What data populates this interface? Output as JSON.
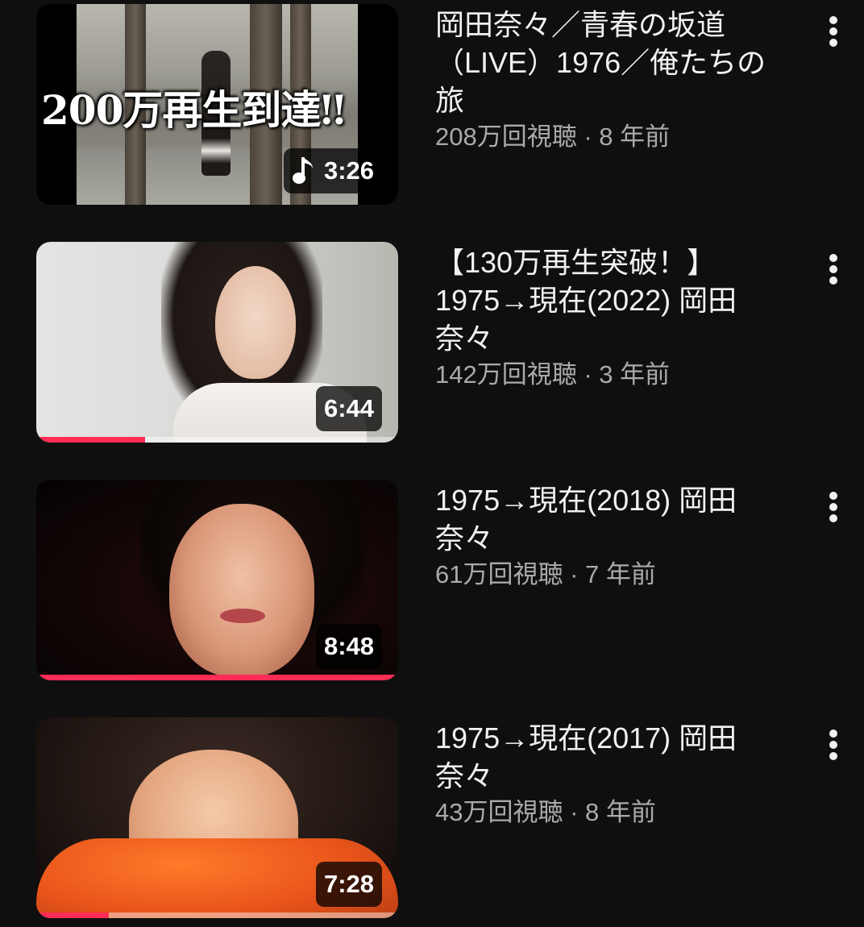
{
  "videos": [
    {
      "thumbnail_text": "200万再生到達‼",
      "duration": "3:26",
      "badge_icon": "music-note-icon",
      "title": "岡田奈々／青春の坂道\n（LIVE）1976／俺たちの\n旅",
      "views": "208万回視聴",
      "age": "8 年前",
      "separator": " · ",
      "watch_progress": null
    },
    {
      "duration": "6:44",
      "title": "【130万再生突破！】\n1975→現在(2022) 岡田\n奈々",
      "views": "142万回視聴",
      "age": "3 年前",
      "separator": " · ",
      "watch_progress": 0.3
    },
    {
      "duration": "8:48",
      "title": "1975→現在(2018) 岡田\n奈々",
      "views": "61万回視聴",
      "age": "7 年前",
      "separator": " · ",
      "watch_progress": 1.0
    },
    {
      "duration": "7:28",
      "title": "1975→現在(2017) 岡田\n奈々",
      "views": "43万回視聴",
      "age": "8 年前",
      "separator": " · ",
      "watch_progress": 0.2
    }
  ],
  "colors": {
    "background": "#0f0f0f",
    "title_text": "#f1f1f1",
    "secondary_text": "#aaaaaa",
    "progress_bar": "#ff2d55"
  },
  "icons": {
    "more": "more-vert-icon",
    "music": "music-note-icon"
  }
}
